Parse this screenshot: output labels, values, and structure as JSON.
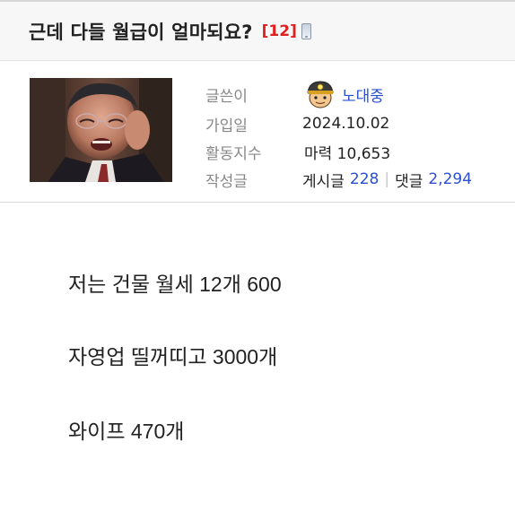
{
  "post": {
    "title": "근데 다들 월급이 얼마되요?",
    "comment_count": "[12]",
    "lines": [
      "저는 건물 월세 12개 600",
      "자영업 띨꺼띠고 3000개",
      "와이프 470개"
    ]
  },
  "author": {
    "labels": {
      "writer": "글쓴이",
      "joined": "가입일",
      "activity": "활동지수",
      "posts": "작성글"
    },
    "nickname": "노대중",
    "joined": "2024.10.02",
    "activity_value": "마력 10,653",
    "posts_label": "게시글",
    "posts_count": "228",
    "separator": "|",
    "comments_label": "댓글",
    "comments_count": "2,294"
  },
  "icons": {
    "mobile": "mobile-phone-icon",
    "nickname_badge": "miner-character-icon"
  },
  "colors": {
    "accent_red": "#e02020",
    "link_blue": "#2a4fd3",
    "label_gray": "#888888"
  }
}
